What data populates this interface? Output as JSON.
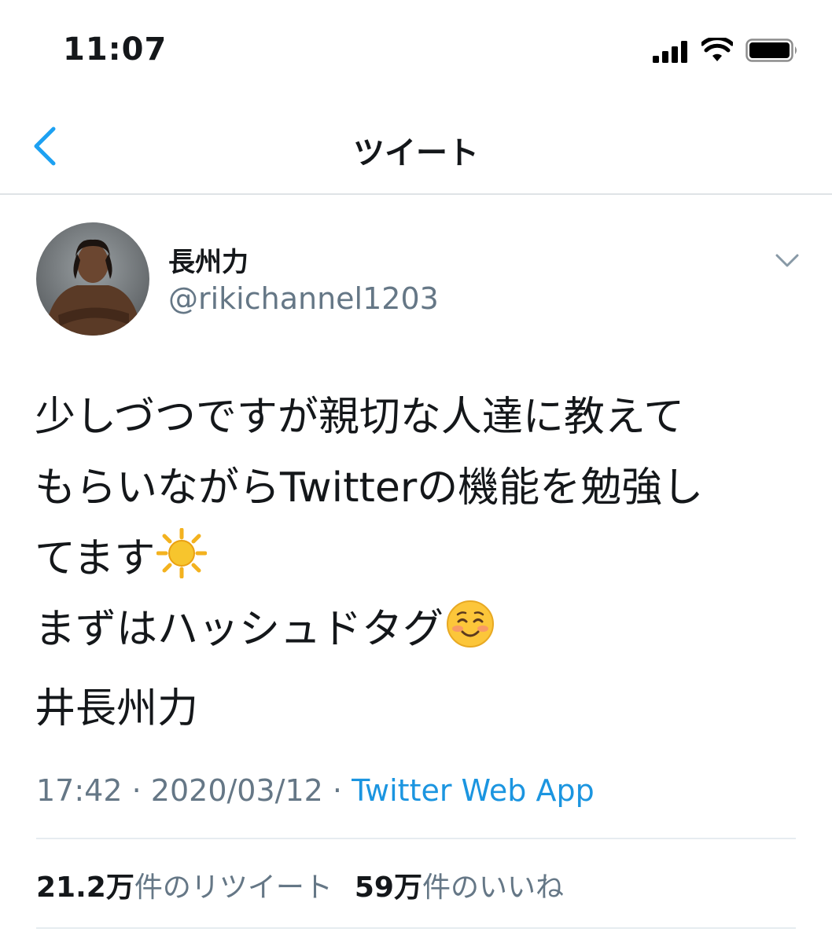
{
  "status_bar": {
    "time": "11:07"
  },
  "nav": {
    "title": "ツイート",
    "back_icon": "chevron-left-icon"
  },
  "tweet": {
    "author_name": "長州力",
    "author_handle": "@rikichannel1203",
    "body_lines": [
      "少しづつですが親切な人達に教えて",
      "もらいながらTwitterの機能を勉強し",
      "てます",
      "まずはハッシュドタグ"
    ],
    "emoji_sun": "sun-emoji",
    "emoji_smile": "smiling-face-emoji",
    "hashtag_text": "井長州力",
    "time": "17:42",
    "separator": "·",
    "date": "2020/03/12",
    "source": "Twitter Web App",
    "retweet_count": "21.2万",
    "retweet_label": "件のリツイート",
    "like_count": "59万",
    "like_label": "件のいいね"
  },
  "colors": {
    "link": "#1b95e0",
    "secondary": "#657786",
    "text": "#14171a",
    "divider": "#e6ecf0"
  }
}
